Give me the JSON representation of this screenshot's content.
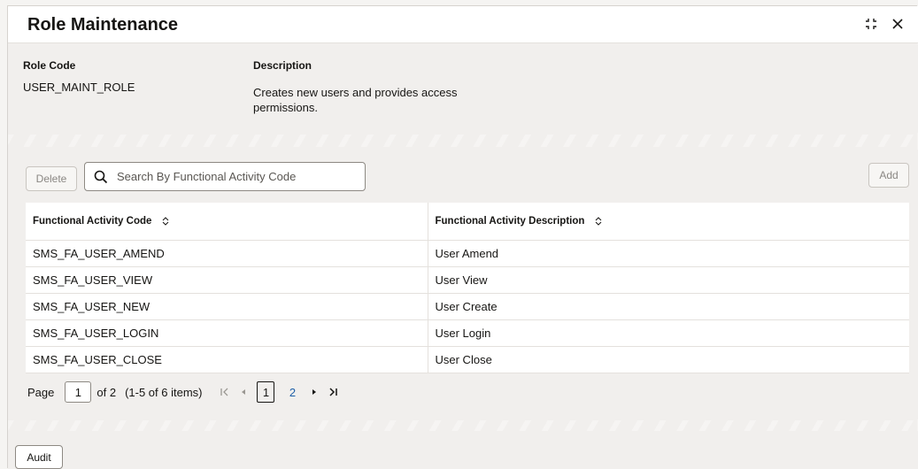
{
  "window": {
    "title": "Role Maintenance"
  },
  "header": {
    "role_code_label": "Role Code",
    "role_code_value": "USER_MAINT_ROLE",
    "description_label": "Description",
    "description_value_line1": "Creates new users and provides access",
    "description_value_line2": "permissions."
  },
  "toolbar": {
    "delete_label": "Delete",
    "search_placeholder": "Search By Functional Activity Code",
    "add_label": "Add"
  },
  "table": {
    "columns": [
      "Functional Activity Code",
      "Functional Activity Description"
    ],
    "rows": [
      [
        "SMS_FA_USER_AMEND",
        "User Amend"
      ],
      [
        "SMS_FA_USER_VIEW",
        "User View"
      ],
      [
        "SMS_FA_USER_NEW",
        "User Create"
      ],
      [
        "SMS_FA_USER_LOGIN",
        "User Login"
      ],
      [
        "SMS_FA_USER_CLOSE",
        "User Close"
      ]
    ]
  },
  "pagination": {
    "page_label": "Page",
    "current_page": "1",
    "of_label": "of 2",
    "items_label": "(1-5 of 6 items)",
    "pages": [
      "1",
      "2"
    ]
  },
  "footer": {
    "audit_label": "Audit"
  }
}
